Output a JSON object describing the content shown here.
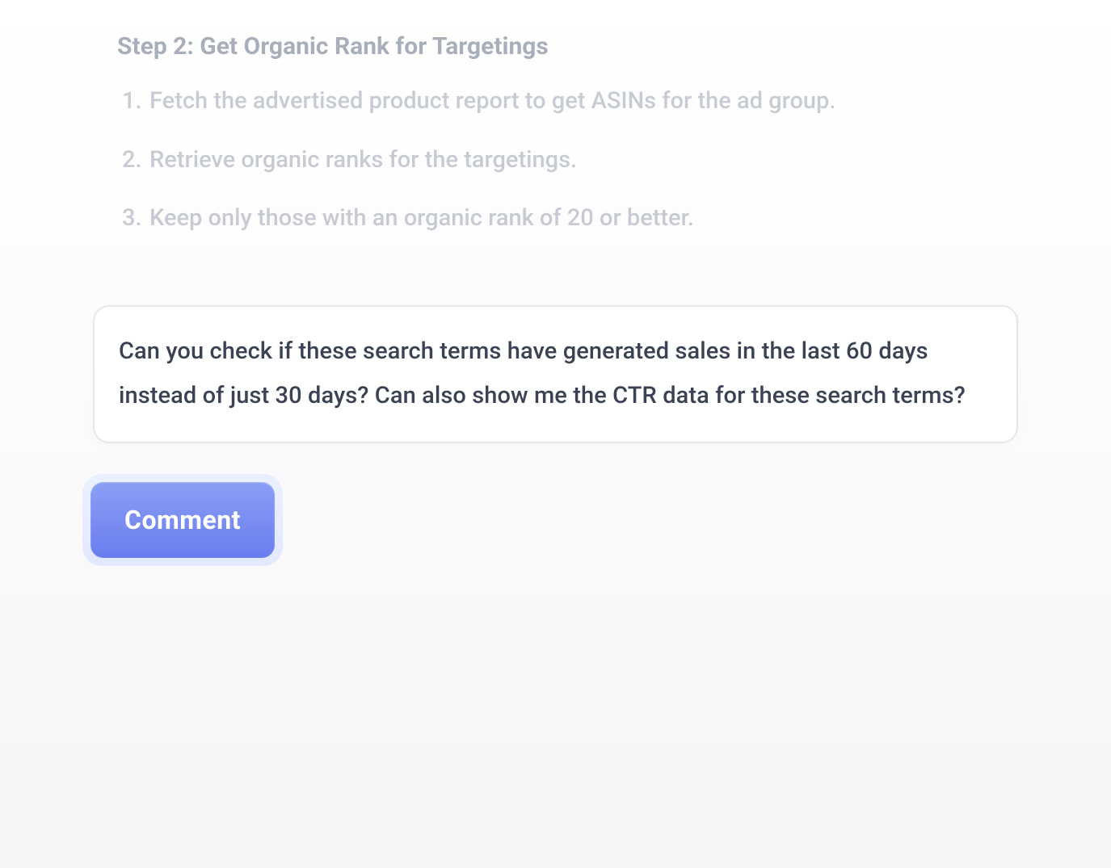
{
  "step": {
    "title": "Step 2: Get Organic Rank for Targetings",
    "items": [
      "Fetch the advertised product report to get ASINs for the ad group.",
      "Retrieve organic ranks for the targetings.",
      "Keep only those with an organic rank of 20 or better."
    ]
  },
  "input": {
    "text": "Can you check if these search terms have generated sales in the last 60 days instead of just 30 days? Can also show me the CTR data for these search terms?"
  },
  "actions": {
    "comment_label": "Comment"
  }
}
